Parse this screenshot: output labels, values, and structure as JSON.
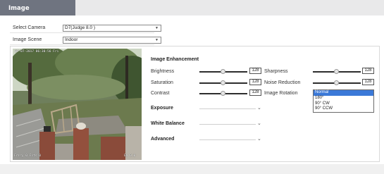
{
  "tab": {
    "title": "Image"
  },
  "settings": {
    "camera_label": "Select Camera",
    "camera_value": "D7(Judge 8.0 )",
    "scene_label": "Image Scene",
    "scene_value": "Indoor"
  },
  "preview": {
    "osd_datetime": "07-07-2017 06:30:56 Fri",
    "osd_bottom_left": "Frmry  0  Fnts  0",
    "osd_bottom_right": "Em  0.0"
  },
  "enhancement": {
    "title": "Image Enhancement",
    "brightness": {
      "label": "Brightness",
      "value": "128",
      "level": 0.5
    },
    "saturation": {
      "label": "Saturation",
      "value": "128",
      "level": 0.5
    },
    "contrast": {
      "label": "Contrast",
      "value": "128",
      "level": 0.5
    },
    "sharpness": {
      "label": "Sharpness",
      "value": "128",
      "level": 0.5
    },
    "noise_reduction": {
      "label": "Noise Reduction",
      "value": "128",
      "level": 0.5
    },
    "image_rotation": {
      "label": "Image Rotation",
      "options": [
        "Normal",
        "180°",
        "90° CW",
        "90° CCW"
      ],
      "selected": "Normal"
    }
  },
  "sections": {
    "exposure": "Exposure",
    "white_balance": "White Balance",
    "advanced": "Advanced"
  },
  "colors": {
    "tab_active": "#6f7480",
    "tabbar": "#e9e9ea",
    "selection": "#3b79d8"
  }
}
